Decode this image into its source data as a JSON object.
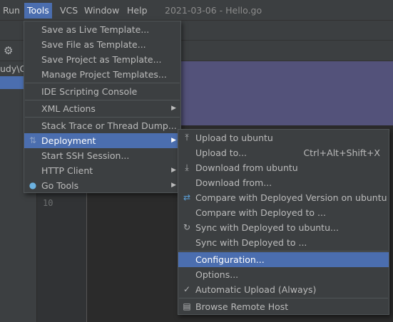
{
  "menubar": {
    "items": [
      "Run",
      "Tools",
      "VCS",
      "Window",
      "Help"
    ],
    "title": "2021-03-06 - Hello.go"
  },
  "project_pane": {
    "path_fragment": "udy\\G"
  },
  "editor": {
    "line_number": "10"
  },
  "tools_menu": {
    "items": [
      {
        "label": "Save as Live Template...",
        "submenu": false
      },
      {
        "label": "Save File as Template...",
        "submenu": false
      },
      {
        "label": "Save Project as Template...",
        "submenu": false
      },
      {
        "label": "Manage Project Templates...",
        "submenu": false
      },
      {
        "label": "IDE Scripting Console",
        "submenu": false
      },
      {
        "label": "XML Actions",
        "submenu": true
      },
      {
        "label": "Stack Trace or Thread Dump...",
        "submenu": false
      },
      {
        "label": "Deployment",
        "submenu": true,
        "selected": true,
        "icon": "deployment-icon"
      },
      {
        "label": "Start SSH Session...",
        "submenu": false
      },
      {
        "label": "HTTP Client",
        "submenu": true
      },
      {
        "label": "Go Tools",
        "submenu": true,
        "icon": "gopher-icon"
      }
    ]
  },
  "deployment_menu": {
    "items": [
      {
        "label": "Upload to ubuntu",
        "icon": "upload-icon"
      },
      {
        "label": "Upload to...",
        "shortcut": "Ctrl+Alt+Shift+X"
      },
      {
        "label": "Download from ubuntu",
        "icon": "download-icon"
      },
      {
        "label": "Download from..."
      },
      {
        "label": "Compare with Deployed Version on ubuntu",
        "icon": "compare-icon"
      },
      {
        "label": "Compare with Deployed to ..."
      },
      {
        "label": "Sync with Deployed to ubuntu...",
        "icon": "sync-icon"
      },
      {
        "label": "Sync with Deployed to ..."
      },
      {
        "label": "Configuration...",
        "selected": true
      },
      {
        "label": "Options..."
      },
      {
        "label": "Automatic Upload (Always)",
        "icon": "check-icon",
        "checked": true
      },
      {
        "label": "Browse Remote Host",
        "icon": "browse-remote-host-icon"
      }
    ]
  },
  "colors": {
    "menu_bg": "#3c3f41",
    "selection": "#4b6eaf",
    "text": "#bbbbbb"
  }
}
